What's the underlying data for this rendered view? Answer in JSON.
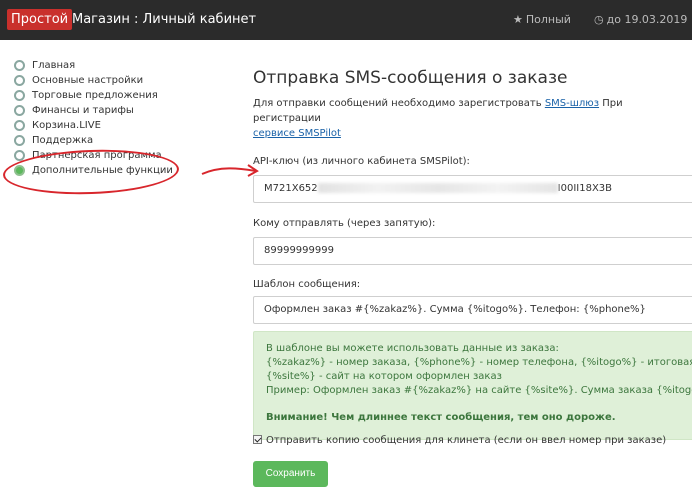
{
  "header": {
    "brand": "Простой",
    "title": "Магазин : Личный кабинет",
    "plan": "Полный",
    "expiry": "до 19.03.2019"
  },
  "sidebar": {
    "items": [
      {
        "label": "Главная"
      },
      {
        "label": "Основные настройки"
      },
      {
        "label": "Торговые предложения"
      },
      {
        "label": "Финансы и тарифы"
      },
      {
        "label": "Корзина.LIVE"
      },
      {
        "label": "Поддержка"
      },
      {
        "label": "Партнерская программа"
      },
      {
        "label": "Дополнительные функции"
      }
    ]
  },
  "main": {
    "title": "Отправка SMS-сообщения о заказе",
    "intro_before": "Для отправки сообщений необходимо зарегистровать ",
    "intro_link": "SMS-шлюз",
    "intro_middle": " При регистрации ",
    "intro_link2": "сервисе SMSPilot",
    "api_label": "API-ключ (из личного кабинета SMSPilot):",
    "api_prefix": "M721X652",
    "api_suffix": "I00II18X3B",
    "to_label": "Кому отправлять (через запятую):",
    "to_value": "89999999999",
    "template_label": "Шаблон сообщения:",
    "template_value": "Оформлен заказ #{%zakaz%}. Сумма {%itogo%}. Телефон: {%phone%}",
    "info_lines": [
      "В шаблоне вы можете использовать данные из заказа:",
      "{%zakaz%} - номер заказа, {%phone%} - номер телефона, {%itogo%} - итоговая сумма",
      "{%site%} - сайт на котором оформлен заказ",
      "Пример: Оформлен заказ #{%zakaz%} на сайте {%site%}. Сумма заказа {%itogo%}"
    ],
    "info_warning": "Внимание! Чем длиннее текст сообщения, тем оно дороже.",
    "copy_checkbox_label": "Отправить копию сообщения для клинета (если он ввел номер при заказе)",
    "copy_checked": true,
    "save_label": "Сохранить"
  },
  "icons": {
    "plan": "star-icon",
    "expiry": "clock-icon"
  },
  "colors": {
    "topbar": "#2b2b2b",
    "brand": "#c9302c",
    "save_button": "#5cb85c",
    "info_bg": "#dff0d8",
    "annotation": "#d8262c"
  }
}
